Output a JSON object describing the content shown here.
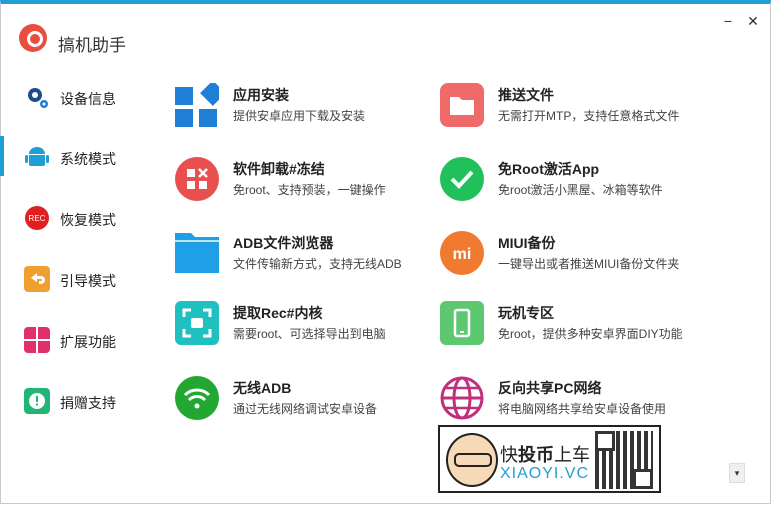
{
  "app": {
    "title": "搞机助手",
    "minimize": "−",
    "close": "✕",
    "accent": "#1f9fd6"
  },
  "sidebar": {
    "items": [
      {
        "label": "设备信息",
        "icon": "gear-icon",
        "color": "#1e4d8c"
      },
      {
        "label": "系统模式",
        "icon": "android-icon",
        "color": "#1f9fd6",
        "selected": true
      },
      {
        "label": "恢复模式",
        "icon": "rec-icon",
        "color": "#e02020"
      },
      {
        "label": "引导模式",
        "icon": "back-arrow-icon",
        "color": "#f0a030"
      },
      {
        "label": "扩展功能",
        "icon": "grid-icon",
        "color": "#e0306a"
      },
      {
        "label": "捐赠支持",
        "icon": "alert-icon",
        "color": "#22b573"
      }
    ]
  },
  "cards": [
    {
      "title": "应用安装",
      "desc": "提供安卓应用下载及安装",
      "icon": "app-store-icon",
      "color": "#1f7fd6"
    },
    {
      "title": "推送文件",
      "desc": "无需打开MTP，支持任意格式文件",
      "icon": "folder-icon",
      "color": "#f06a6a"
    },
    {
      "title": "软件卸载#冻结",
      "desc": "免root、支持预装，一键操作",
      "icon": "uninstall-icon",
      "color": "#e85050"
    },
    {
      "title": "免Root激活App",
      "desc": "免root激活小黑屋、冰箱等软件",
      "icon": "check-icon",
      "color": "#22c05a"
    },
    {
      "title": "ADB文件浏览器",
      "desc": "文件传输新方式，支持无线ADB",
      "icon": "folder-open-icon",
      "color": "#1fa0e6"
    },
    {
      "title": "MIUI备份",
      "desc": "一键导出或者推送MIUI备份文件夹",
      "icon": "mi-icon",
      "color": "#f07a30"
    },
    {
      "title": "提取Rec#内核",
      "desc": "需要root、可选择导出到电脑",
      "icon": "screenshot-icon",
      "color": "#20c0c0"
    },
    {
      "title": "玩机专区",
      "desc": "免root，提供多种安卓界面DIY功能",
      "icon": "phone-icon",
      "color": "#5cc870"
    },
    {
      "title": "无线ADB",
      "desc": "通过无线网络调试安卓设备",
      "icon": "wifi-icon",
      "color": "#22a832"
    },
    {
      "title": "反向共享PC网络",
      "desc": "将电脑网络共享给安卓设备使用",
      "icon": "globe-icon",
      "color": "#c0307a"
    }
  ],
  "ad": {
    "part1": "快",
    "part2": "投币",
    "part3": "上车",
    "site": "XIAOYI.VC"
  },
  "scroll_glyph": "▾"
}
